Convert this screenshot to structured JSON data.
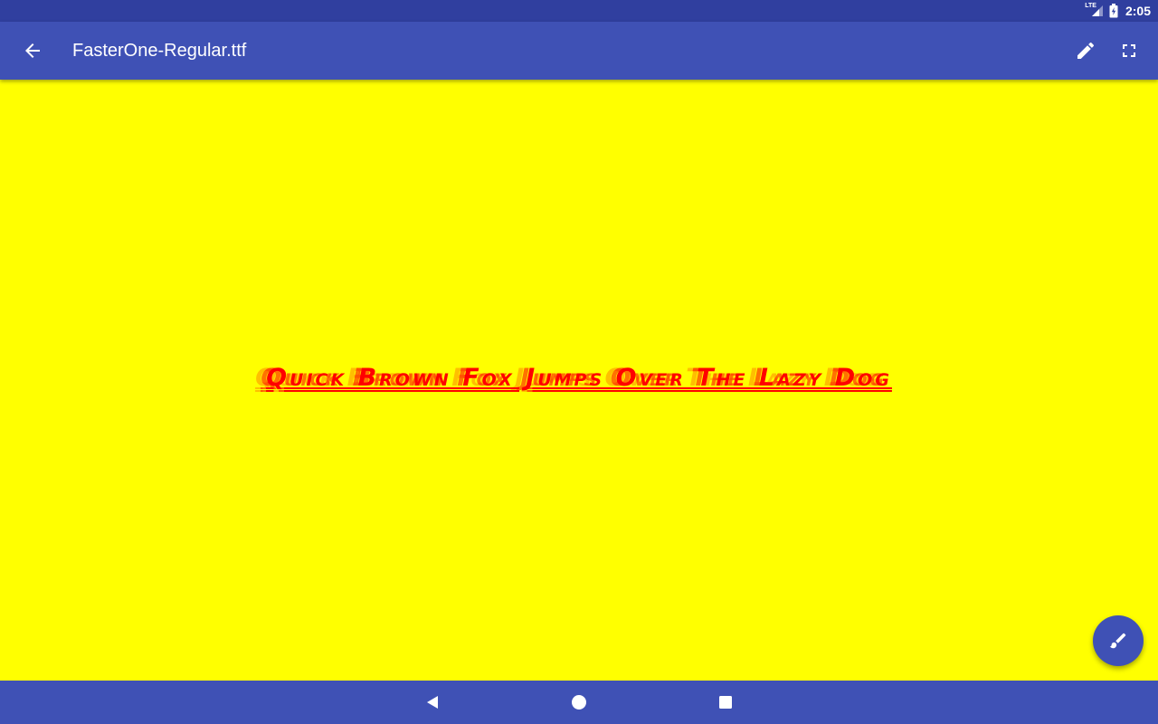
{
  "status_bar": {
    "network_label": "LTE",
    "time": "2:05",
    "icons": [
      "signal-icon",
      "battery-charging-icon"
    ]
  },
  "app_bar": {
    "title": "FasterOne-Regular.ttf",
    "icons": [
      "arrow-back-icon",
      "pencil-icon",
      "fullscreen-icon"
    ]
  },
  "preview": {
    "sample_text": "Quick Brown Fox Jumps Over The Lazy Dog",
    "background_color": "#ffff00",
    "text_color": "#ff0000"
  },
  "fab": {
    "icon": "brush-icon"
  },
  "nav_bar": {
    "icons": [
      "nav-back-icon",
      "nav-home-icon",
      "nav-recents-icon"
    ]
  },
  "colors": {
    "primary": "#3f51b5",
    "primary_dark": "#303f9f",
    "on_primary": "#ffffff"
  }
}
